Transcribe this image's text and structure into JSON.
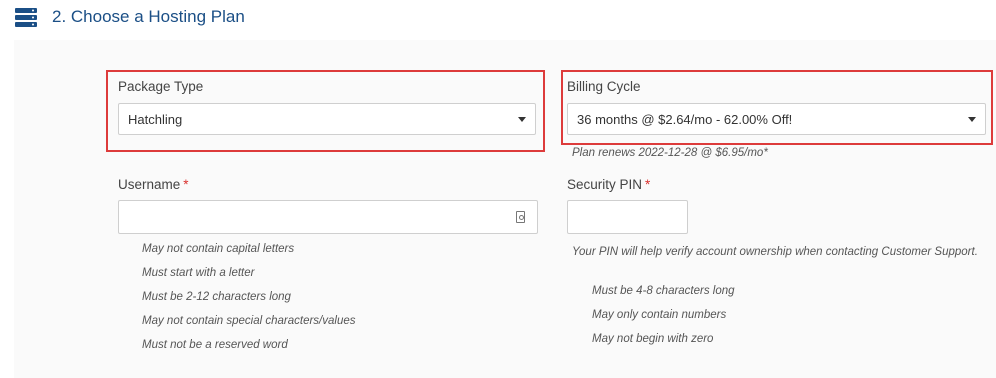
{
  "header": {
    "icon": "server-stack-icon",
    "title": "2. Choose a Hosting Plan"
  },
  "package_type": {
    "label": "Package Type",
    "selected": "Hatchling"
  },
  "billing_cycle": {
    "label": "Billing Cycle",
    "selected": "36 months @ $2.64/mo - 62.00% Off!",
    "renew_note": "Plan renews 2022-12-28 @ $6.95/mo*"
  },
  "username": {
    "label": "Username",
    "required_mark": "*",
    "value": "",
    "icon": "contact-card-icon",
    "rules": [
      "May not contain capital letters",
      "Must start with a letter",
      "Must be 2-12 characters long",
      "May not contain special characters/values",
      "Must not be a reserved word"
    ]
  },
  "security_pin": {
    "label": "Security PIN",
    "required_mark": "*",
    "value": "",
    "help": "Your PIN will help verify account ownership when contacting Customer Support.",
    "rules": [
      "Must be 4-8 characters long",
      "May only contain numbers",
      "May not begin with zero"
    ]
  },
  "colors": {
    "title": "#1b4f86",
    "highlight": "#dd3b3b",
    "required": "#d9312e"
  }
}
